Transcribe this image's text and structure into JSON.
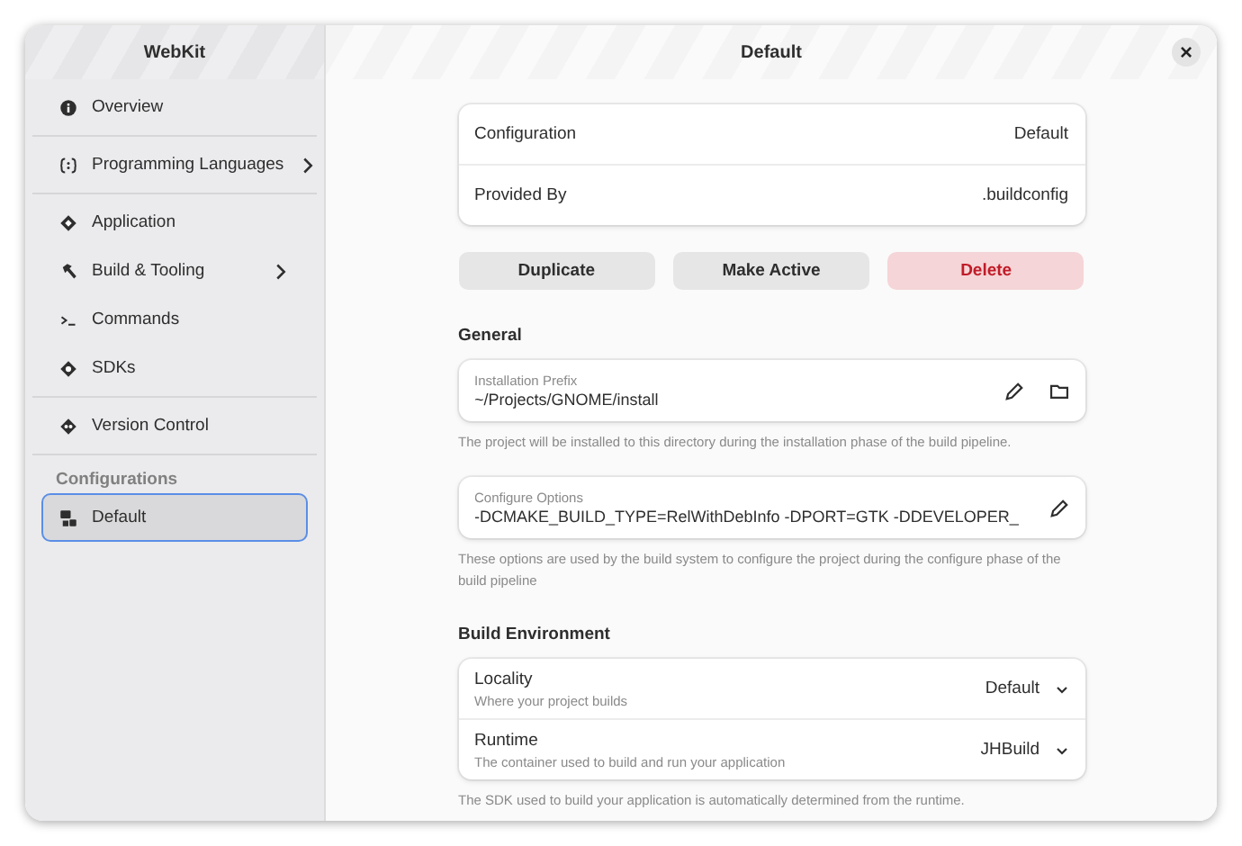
{
  "window": {
    "sidebar_title": "WebKit",
    "title": "Default",
    "close": "×"
  },
  "sidebar": {
    "groups": [
      {
        "items": [
          {
            "label": "Overview",
            "submenu": false,
            "selected": false
          }
        ]
      },
      {
        "items": [
          {
            "label": "Programming Languages",
            "submenu": true,
            "selected": false
          }
        ]
      },
      {
        "items": [
          {
            "label": "Application",
            "submenu": false,
            "selected": false
          },
          {
            "label": "Build & Tooling",
            "submenu": true,
            "selected": false
          },
          {
            "label": "Commands",
            "submenu": false,
            "selected": false
          },
          {
            "label": "SDKs",
            "submenu": false,
            "selected": false
          }
        ]
      },
      {
        "items": [
          {
            "label": "Version Control",
            "submenu": false,
            "selected": false
          }
        ]
      },
      {
        "heading": "Configurations",
        "items": [
          {
            "label": "Default",
            "submenu": false,
            "selected": true
          }
        ]
      }
    ]
  },
  "info": [
    {
      "label": "Configuration",
      "value": "Default"
    },
    {
      "label": "Provided By",
      "value": ".buildconfig"
    }
  ],
  "buttons": [
    {
      "label": "Duplicate",
      "kind": "normal"
    },
    {
      "label": "Make Active",
      "kind": "normal"
    },
    {
      "label": "Delete",
      "kind": "destructive"
    }
  ],
  "general": {
    "heading": "General",
    "fields": [
      {
        "label": "Installation Prefix",
        "value": "~/Projects/GNOME/install",
        "help": "The project will be installed to this directory during the installation phase of the build pipeline."
      },
      {
        "label": "Configure Options",
        "value": "-DCMAKE_BUILD_TYPE=RelWithDebInfo -DPORT=GTK -DDEVELOPER_",
        "help": "These options are used by the build system to configure the project during the configure phase of the build pipeline"
      }
    ]
  },
  "build_environment": {
    "heading": "Build Environment",
    "rows": [
      {
        "title": "Locality",
        "subtitle": "Where your project builds",
        "value": "Default"
      },
      {
        "title": "Runtime",
        "subtitle": "The container used to build and run your application",
        "value": "JHBuild"
      }
    ],
    "help": "The SDK used to build your application is automatically determined from the runtime."
  }
}
